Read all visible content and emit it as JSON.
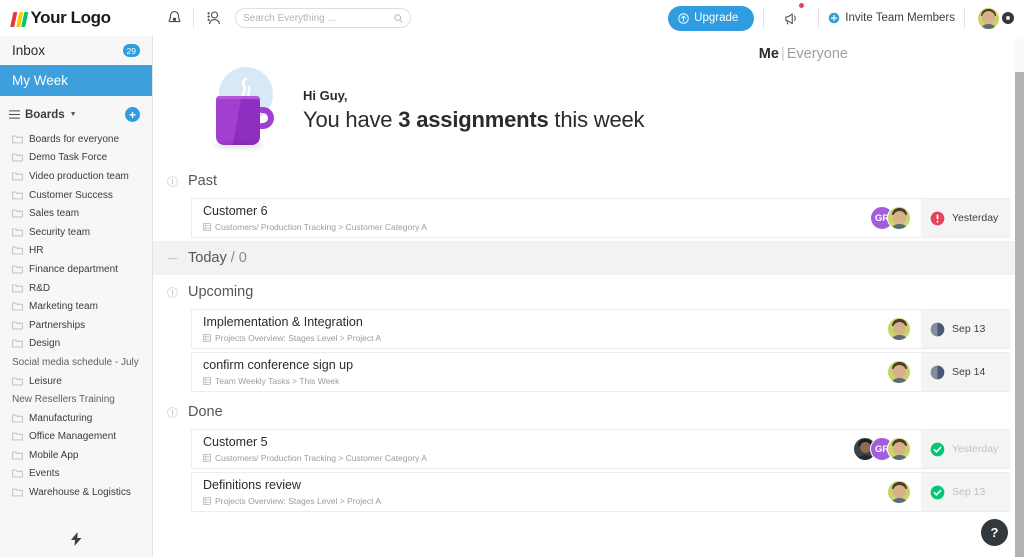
{
  "topbar": {
    "logo_text": "Your Logo",
    "logo_colors": [
      "#e03a3e",
      "#ffcb00",
      "#00c875"
    ],
    "bell_icon": "bell-icon",
    "contacts_icon": "contacts-icon",
    "search": {
      "placeholder": "Search Everything ...",
      "value": "",
      "search_icon": "search-icon"
    },
    "upgrade_label": "Upgrade",
    "upgrade_icon": "upgrade-arrow-icon",
    "upgrade_color": "#2f9de0",
    "announcement_icon": "megaphone-icon",
    "announcement_has_alert": true,
    "invite_label": "Invite Team Members",
    "invite_icon": "plus-circle-icon",
    "avatar": "user-avatar",
    "status_icon": "status-dot-icon"
  },
  "sidebar": {
    "inbox_label": "Inbox",
    "inbox_badge": "29",
    "my_week_label": "My Week",
    "my_week_active": true,
    "my_week_color": "#3d9fdb",
    "boards_label": "Boards",
    "boards_menu_icon": "hamburger-icon",
    "boards_caret_icon": "chevron-down-icon",
    "add_board_icon": "plus-icon",
    "items": [
      {
        "label": "Boards for everyone",
        "type": "folder"
      },
      {
        "label": "Demo Task Force",
        "type": "folder"
      },
      {
        "label": "Video production team",
        "type": "folder"
      },
      {
        "label": "Customer Success",
        "type": "folder"
      },
      {
        "label": "Sales team",
        "type": "folder"
      },
      {
        "label": "Security team",
        "type": "folder"
      },
      {
        "label": "HR",
        "type": "folder"
      },
      {
        "label": "Finance department",
        "type": "folder"
      },
      {
        "label": "R&D",
        "type": "folder"
      },
      {
        "label": "Marketing team",
        "type": "folder"
      },
      {
        "label": "Partnerships",
        "type": "folder"
      },
      {
        "label": "Design",
        "type": "folder"
      },
      {
        "label": "Social media schedule - July",
        "type": "plain"
      },
      {
        "label": "Leisure",
        "type": "folder"
      },
      {
        "label": "New Resellers Training",
        "type": "plain"
      },
      {
        "label": "Manufacturing",
        "type": "folder"
      },
      {
        "label": "Office Management",
        "type": "folder"
      },
      {
        "label": "Mobile App",
        "type": "folder"
      },
      {
        "label": "Events",
        "type": "folder"
      },
      {
        "label": "Warehouse & Logistics",
        "type": "folder"
      }
    ],
    "bolt_icon": "lightning-bolt-icon"
  },
  "main": {
    "filter": {
      "me_label": "Me",
      "separator": "|",
      "everyone_label": "Everyone",
      "active": "Me"
    },
    "greeting": {
      "hi": "Hi Guy,",
      "line_prefix": "You have ",
      "line_highlight": "3 assignments",
      "line_suffix": " this week",
      "illustration": "coffee-mug-icon"
    },
    "sections": [
      {
        "title": "Past",
        "subtitle": "",
        "banded": false,
        "collapse_icon": "collapse-icon",
        "rows": [
          {
            "title": "Customer 6",
            "breadcrumb": "Customers/ Production Tracking > Customer Category A",
            "board_icon": "board-icon",
            "avatars": [
              {
                "kind": "initials",
                "label": "GR",
                "color": "#a25ddc"
              },
              {
                "kind": "photo-light",
                "label": ""
              }
            ],
            "status_icon": "alert-exclamation-icon",
            "status_color": "#e2445c",
            "date": "Yesterday",
            "date_style": "overdue"
          }
        ]
      },
      {
        "title": "Today",
        "subtitle": "/ 0",
        "banded": true,
        "collapse_icon": "minus-icon",
        "rows": []
      },
      {
        "title": "Upcoming",
        "subtitle": "",
        "banded": false,
        "collapse_icon": "collapse-icon",
        "rows": [
          {
            "title": "Implementation & Integration",
            "breadcrumb": "Projects Overview: Stages Level > Project A",
            "board_icon": "board-icon",
            "avatars": [
              {
                "kind": "photo-light",
                "label": ""
              }
            ],
            "status_icon": "clock-pie-icon",
            "status_color": "#4a5874",
            "date": "Sep 13",
            "date_style": "upcoming"
          },
          {
            "title": "confirm conference sign up",
            "breadcrumb": "Team Weekly Tasks > This Week",
            "board_icon": "board-icon",
            "avatars": [
              {
                "kind": "photo-light",
                "label": ""
              }
            ],
            "status_icon": "clock-pie-icon",
            "status_color": "#4a5874",
            "date": "Sep 14",
            "date_style": "upcoming"
          }
        ]
      },
      {
        "title": "Done",
        "subtitle": "",
        "banded": false,
        "collapse_icon": "collapse-icon",
        "rows": [
          {
            "title": "Customer 5",
            "breadcrumb": "Customers/ Production Tracking > Customer Category A",
            "board_icon": "board-icon",
            "avatars": [
              {
                "kind": "photo-dark",
                "label": ""
              },
              {
                "kind": "initials",
                "label": "GR",
                "color": "#a25ddc"
              },
              {
                "kind": "photo-light",
                "label": ""
              }
            ],
            "status_icon": "check-circle-icon",
            "status_color": "#00c875",
            "date": "Yesterday",
            "date_style": "done"
          },
          {
            "title": "Definitions review",
            "breadcrumb": "Projects Overview: Stages Level > Project A",
            "board_icon": "board-icon",
            "avatars": [
              {
                "kind": "photo-light",
                "label": ""
              }
            ],
            "status_icon": "check-circle-icon",
            "status_color": "#00c875",
            "date": "Sep 13",
            "date_style": "done"
          }
        ]
      }
    ]
  },
  "help": {
    "label": "?",
    "icon": "question-mark-icon"
  }
}
